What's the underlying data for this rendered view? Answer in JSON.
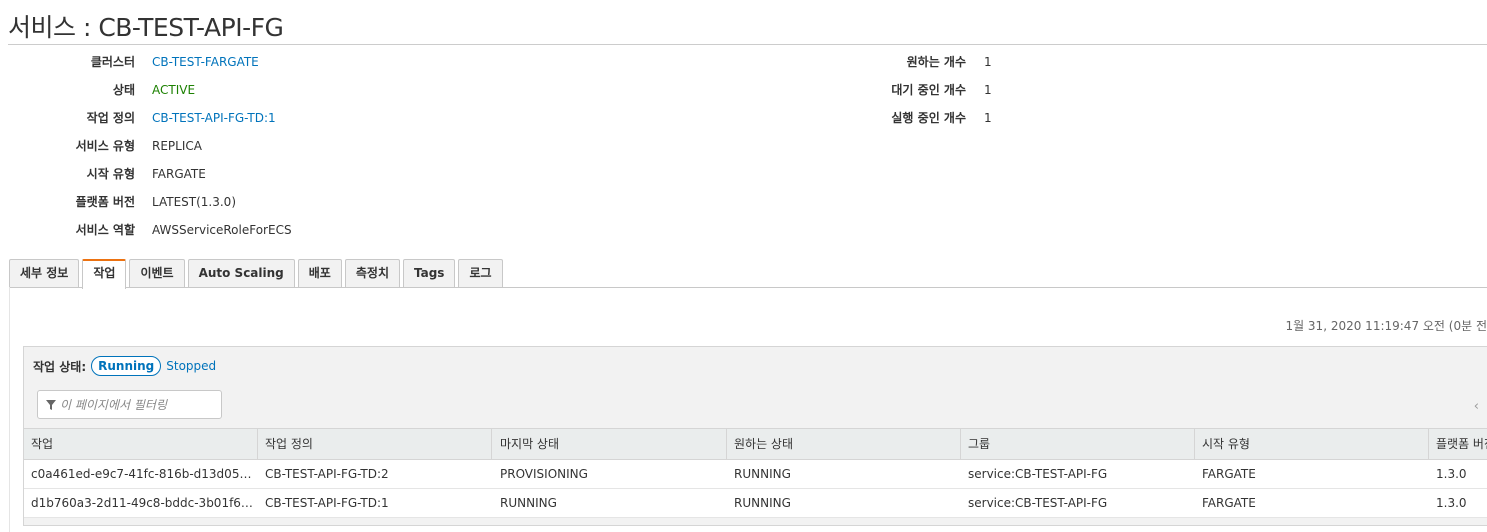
{
  "title": "서비스 : CB-TEST-API-FG",
  "details_left": [
    {
      "key": "클러스터",
      "value": "CB-TEST-FARGATE"
    },
    {
      "key": "상태",
      "value": "ACTIVE"
    },
    {
      "key": "작업 정의",
      "value": "CB-TEST-API-FG-TD:1"
    },
    {
      "key": "서비스 유형",
      "value": "REPLICA"
    },
    {
      "key": "시작 유형",
      "value": "FARGATE"
    },
    {
      "key": "플랫폼 버전",
      "value": "LATEST(1.3.0)"
    },
    {
      "key": "서비스 역할",
      "value": "AWSServiceRoleForECS"
    }
  ],
  "details_right": [
    {
      "key": "원하는 개수",
      "value": "1"
    },
    {
      "key": "대기 중인 개수",
      "value": "1"
    },
    {
      "key": "실행 중인 개수",
      "value": "1"
    }
  ],
  "tabs": [
    {
      "label": "세부 정보",
      "active": false
    },
    {
      "label": "작업",
      "active": true
    },
    {
      "label": "이벤트",
      "active": false
    },
    {
      "label": "Auto Scaling",
      "active": false
    },
    {
      "label": "배포",
      "active": false
    },
    {
      "label": "측정치",
      "active": false
    },
    {
      "label": "Tags",
      "active": false
    },
    {
      "label": "로그",
      "active": false
    }
  ],
  "timestamp": "1월 31, 2020 11:19:47 오전 (0분 전",
  "tasks": {
    "status_label": "작업 상태:",
    "status_running": "Running",
    "status_stopped": "Stopped",
    "filter_placeholder": "이 페이지에서 필터링",
    "pager_prev": "‹",
    "columns": [
      "작업",
      "작업 정의",
      "마지막 상태",
      "원하는 상태",
      "그룹",
      "시작 유형",
      "플랫폼 버전"
    ],
    "rows": [
      {
        "task": "c0a461ed-e9c7-41fc-816b-d13d053…",
        "task_def": "CB-TEST-API-FG-TD:2",
        "last_status": "PROVISIONING",
        "desired_status": "RUNNING",
        "group": "service:CB-TEST-API-FG",
        "launch_type": "FARGATE",
        "platform": "1.3.0"
      },
      {
        "task": "d1b760a3-2d11-49c8-bddc-3b01f6…",
        "task_def": "CB-TEST-API-FG-TD:1",
        "last_status": "RUNNING",
        "desired_status": "RUNNING",
        "group": "service:CB-TEST-API-FG",
        "launch_type": "FARGATE",
        "platform": "1.3.0"
      }
    ]
  },
  "colors": {
    "link": "#0073bb",
    "running": "#1d8102",
    "tab_accent": "#ec7211"
  }
}
